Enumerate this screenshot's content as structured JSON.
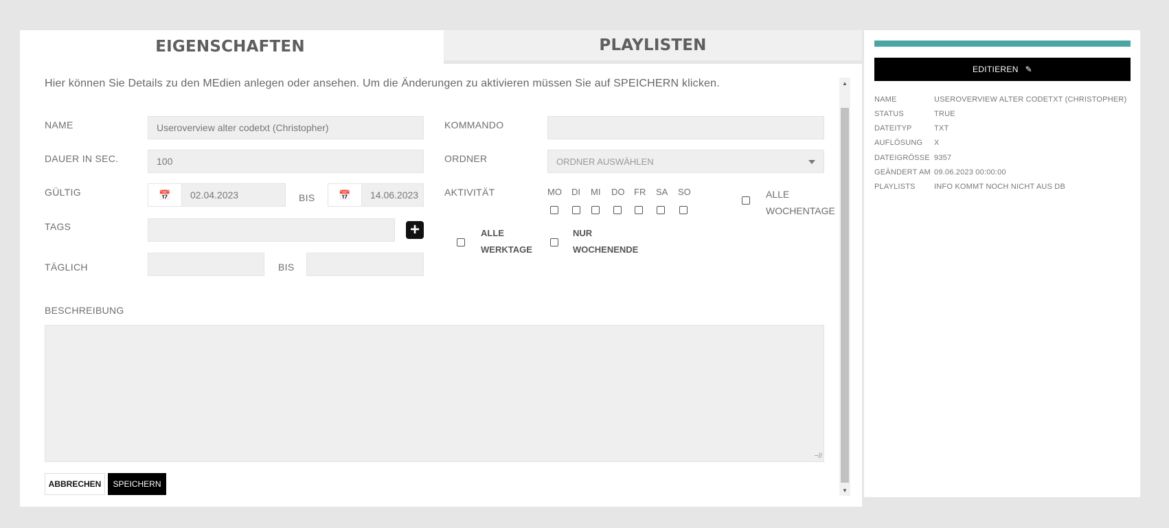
{
  "tabs": {
    "eigenschaften": "EIGENSCHAFTEN",
    "playlisten": "PLAYLISTEN"
  },
  "intro": "Hier können Sie Details zu den MEdien anlegen oder ansehen. Um die Änderungen zu aktivieren müssen Sie auf SPEICHERN klicken.",
  "form": {
    "name_label": "NAME",
    "name_value": "Useroverview alter codetxt (Christopher)",
    "dauer_label": "DAUER IN SEC.",
    "dauer_value": "100",
    "gueltig_label": "GÜLTIG",
    "gueltig_from": "02.04.2023",
    "bis_label": "BIS",
    "gueltig_to": "14.06.2023",
    "tags_label": "TAGS",
    "taeglich_label": "TÄGLICH",
    "taeglich_bis_label": "BIS",
    "kommando_label": "KOMMANDO",
    "ordner_label": "ORDNER",
    "ordner_placeholder": "ORDNER AUSWÄHLEN",
    "aktivitaet_label": "AKTIVITÄT",
    "days": [
      "MO",
      "DI",
      "MI",
      "DO",
      "FR",
      "SA",
      "SO"
    ],
    "alle_wochentage": [
      "ALLE",
      "WOCHENTAGE"
    ],
    "alle_werktage": [
      "ALLE",
      "WERKTAGE"
    ],
    "nur_wochenende": [
      "NUR",
      "WOCHENENDE"
    ],
    "beschreibung_label": "BESCHREIBUNG",
    "cancel": "ABBRECHEN",
    "save": "SPEICHERN"
  },
  "icons": {
    "calendar": "calendar-icon",
    "plus": "plus-icon",
    "edit": "edit-icon"
  },
  "sidebar": {
    "edit_button": "EDITIEREN",
    "accent_color": "#4aa5a5",
    "rows": [
      {
        "k": "NAME",
        "v": "USEROVERVIEW ALTER CODETXT (CHRISTOPHER)"
      },
      {
        "k": "STATUS",
        "v": "TRUE"
      },
      {
        "k": "DATEITYP",
        "v": "TXT"
      },
      {
        "k": "AUFLÖSUNG",
        "v": "X"
      },
      {
        "k": "DATEIGRÖSSE",
        "v": "9357"
      },
      {
        "k": "GEÄNDERT AM",
        "v": "09.06.2023 00:00:00"
      },
      {
        "k": "PLAYLISTS",
        "v": "INFO KOMMT NOCH NICHT AUS DB"
      }
    ]
  }
}
